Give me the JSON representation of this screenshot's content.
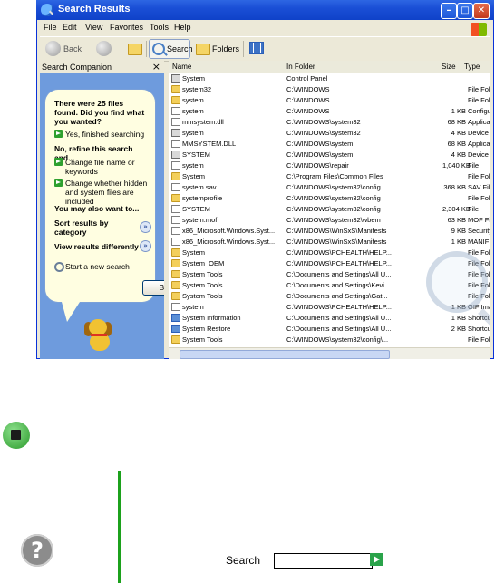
{
  "window": {
    "title": "Search Results",
    "controls": [
      "minimize",
      "maximize",
      "close"
    ]
  },
  "menu": [
    "File",
    "Edit",
    "View",
    "Favorites",
    "Tools",
    "Help"
  ],
  "toolbar": {
    "back_label": "Back",
    "search_label": "Search",
    "folders_label": "Folders"
  },
  "companion": {
    "header": "Search Companion",
    "found_text": "There were 25 files found. Did you find what you wanted?",
    "yes_label": "Yes, finished searching",
    "refine_title": "No, refine this search and...",
    "change_name_label": "Change file name or keywords",
    "change_hidden_label": "Change whether hidden and system files are included",
    "also_want": "You may also want to...",
    "sort_label": "Sort results by category",
    "view_label": "View results differently",
    "new_search_label": "Start a new search",
    "back_button": "Back"
  },
  "columns": {
    "name": "Name",
    "folder": "In Folder",
    "size": "Size",
    "type": "Type"
  },
  "files": [
    {
      "name": "System",
      "folder": "Control Panel",
      "size": "",
      "type": "",
      "icon": "sys"
    },
    {
      "name": "system32",
      "folder": "C:\\WINDOWS",
      "size": "",
      "type": "File Folder",
      "icon": "folder"
    },
    {
      "name": "system",
      "folder": "C:\\WINDOWS",
      "size": "",
      "type": "File Folder",
      "icon": "folder"
    },
    {
      "name": "system",
      "folder": "C:\\WINDOWS",
      "size": "1 KB",
      "type": "Configuration",
      "icon": "file"
    },
    {
      "name": "mmsystem.dll",
      "folder": "C:\\WINDOWS\\system32",
      "size": "68 KB",
      "type": "Application",
      "icon": "file"
    },
    {
      "name": "system",
      "folder": "C:\\WINDOWS\\system32",
      "size": "4 KB",
      "type": "Device driver",
      "icon": "sys"
    },
    {
      "name": "MMSYSTEM.DLL",
      "folder": "C:\\WINDOWS\\system",
      "size": "68 KB",
      "type": "Application",
      "icon": "file"
    },
    {
      "name": "SYSTEM",
      "folder": "C:\\WINDOWS\\system",
      "size": "4 KB",
      "type": "Device driver",
      "icon": "sys"
    },
    {
      "name": "system",
      "folder": "C:\\WINDOWS\\repair",
      "size": "1,040 KB",
      "type": "File",
      "icon": "file"
    },
    {
      "name": "System",
      "folder": "C:\\Program Files\\Common Files",
      "size": "",
      "type": "File Folder",
      "icon": "folder"
    },
    {
      "name": "system.sav",
      "folder": "C:\\WINDOWS\\system32\\config",
      "size": "368 KB",
      "type": "SAV File",
      "icon": "file"
    },
    {
      "name": "systemprofile",
      "folder": "C:\\WINDOWS\\system32\\config",
      "size": "",
      "type": "File Folder",
      "icon": "folder"
    },
    {
      "name": "SYSTEM",
      "folder": "C:\\WINDOWS\\system32\\config",
      "size": "2,304 KB",
      "type": "File",
      "icon": "file"
    },
    {
      "name": "system.mof",
      "folder": "C:\\WINDOWS\\system32\\wbem",
      "size": "63 KB",
      "type": "MOF File",
      "icon": "file"
    },
    {
      "name": "x86_Microsoft.Windows.Syst...",
      "folder": "C:\\WINDOWS\\WinSxS\\Manifests",
      "size": "9 KB",
      "type": "Security Cat",
      "icon": "file"
    },
    {
      "name": "x86_Microsoft.Windows.Syst...",
      "folder": "C:\\WINDOWS\\WinSxS\\Manifests",
      "size": "1 KB",
      "type": "MANIFEST",
      "icon": "file"
    },
    {
      "name": "System",
      "folder": "C:\\WINDOWS\\PCHEALTH\\HELP...",
      "size": "",
      "type": "File Folder",
      "icon": "folder"
    },
    {
      "name": "System_OEM",
      "folder": "C:\\WINDOWS\\PCHEALTH\\HELP...",
      "size": "",
      "type": "File Folder",
      "icon": "folder"
    },
    {
      "name": "System Tools",
      "folder": "C:\\Documents and Settings\\All U...",
      "size": "",
      "type": "File Folder",
      "icon": "folder"
    },
    {
      "name": "System Tools",
      "folder": "C:\\Documents and Settings\\Kevi...",
      "size": "",
      "type": "File Folder",
      "icon": "folder"
    },
    {
      "name": "System Tools",
      "folder": "C:\\Documents and Settings\\Gat...",
      "size": "",
      "type": "File Folder",
      "icon": "folder"
    },
    {
      "name": "system",
      "folder": "C:\\WINDOWS\\PCHEALTH\\HELP...",
      "size": "1 KB",
      "type": "GIF Image",
      "icon": "file"
    },
    {
      "name": "System Information",
      "folder": "C:\\Documents and Settings\\All U...",
      "size": "1 KB",
      "type": "Shortcut",
      "icon": "app"
    },
    {
      "name": "System Restore",
      "folder": "C:\\Documents and Settings\\All U...",
      "size": "2 KB",
      "type": "Shortcut",
      "icon": "app"
    },
    {
      "name": "System Tools",
      "folder": "C:\\WINDOWS\\system32\\config\\...",
      "size": "",
      "type": "File Folder",
      "icon": "folder"
    }
  ],
  "bottom": {
    "search_label": "Search",
    "search_value": ""
  }
}
